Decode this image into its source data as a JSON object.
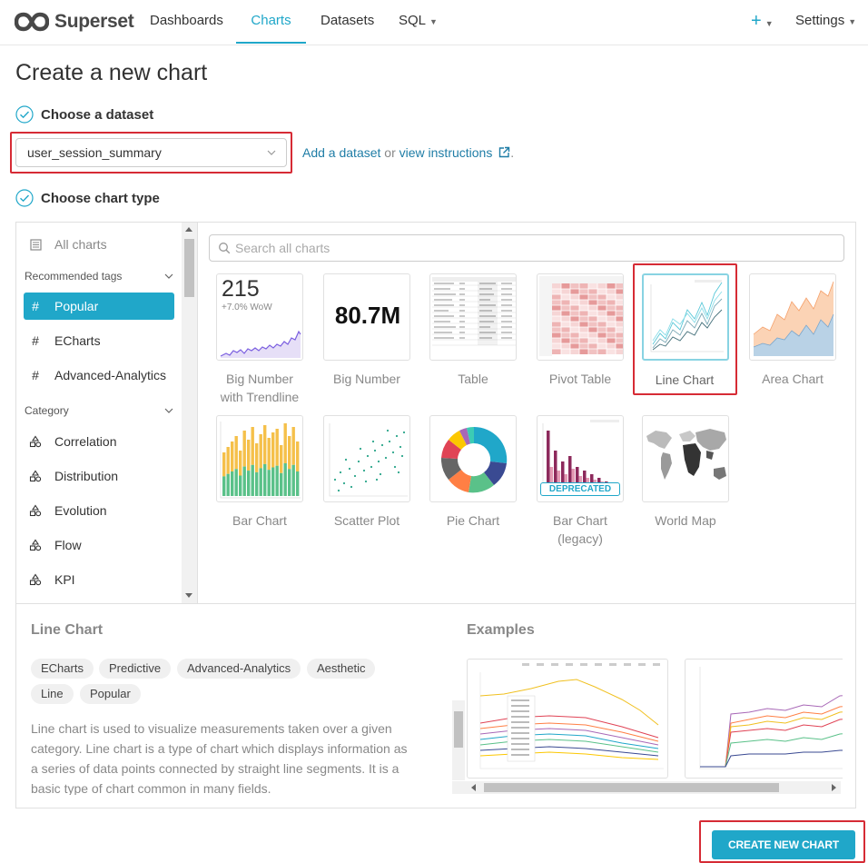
{
  "app": {
    "name": "Superset"
  },
  "nav": {
    "items": [
      "Dashboards",
      "Charts",
      "Datasets",
      "SQL"
    ],
    "active": "Charts",
    "plus_label": "+",
    "settings_label": "Settings"
  },
  "page": {
    "title": "Create a new chart"
  },
  "steps": {
    "dataset": "Choose a dataset",
    "chart_type": "Choose chart type"
  },
  "dataset": {
    "selected": "user_session_summary",
    "add_link": "Add a dataset",
    "or": "or",
    "instructions_link": "view instructions",
    "period": "."
  },
  "sidebar": {
    "all_charts": "All charts",
    "recommended_tags_header": "Recommended tags",
    "tags": [
      "Popular",
      "ECharts",
      "Advanced-Analytics"
    ],
    "active_tag": "Popular",
    "category_header": "Category",
    "categories": [
      "Correlation",
      "Distribution",
      "Evolution",
      "Flow",
      "KPI"
    ]
  },
  "search": {
    "placeholder": "Search all charts"
  },
  "charts": [
    {
      "name": "Big Number with Trendline",
      "line1": "Big Number",
      "line2": "with Trendline",
      "thumb_number": "215",
      "thumb_sub": "+7.0% WoW"
    },
    {
      "name": "Big Number",
      "thumb_number": "80.7M"
    },
    {
      "name": "Table"
    },
    {
      "name": "Pivot Table"
    },
    {
      "name": "Line Chart",
      "selected": true
    },
    {
      "name": "Area Chart"
    },
    {
      "name": "Bar Chart"
    },
    {
      "name": "Scatter Plot"
    },
    {
      "name": "Pie Chart"
    },
    {
      "name": "Bar Chart (legacy)",
      "line1": "Bar Chart",
      "line2": "(legacy)",
      "badge": "DEPRECATED"
    },
    {
      "name": "World Map"
    }
  ],
  "details": {
    "title": "Line Chart",
    "tags": [
      "ECharts",
      "Predictive",
      "Advanced-Analytics",
      "Aesthetic",
      "Line",
      "Popular"
    ],
    "description": "Line chart is used to visualize measurements taken over a given category. Line chart is a type of chart which displays information as a series of data points connected by straight line segments. It is a basic type of chart common in many fields.",
    "examples_title": "Examples"
  },
  "footer": {
    "create_button": "CREATE NEW CHART"
  },
  "colors": {
    "accent": "#20a7c9",
    "highlight_box": "#d62b35",
    "link": "#1f7da6"
  }
}
